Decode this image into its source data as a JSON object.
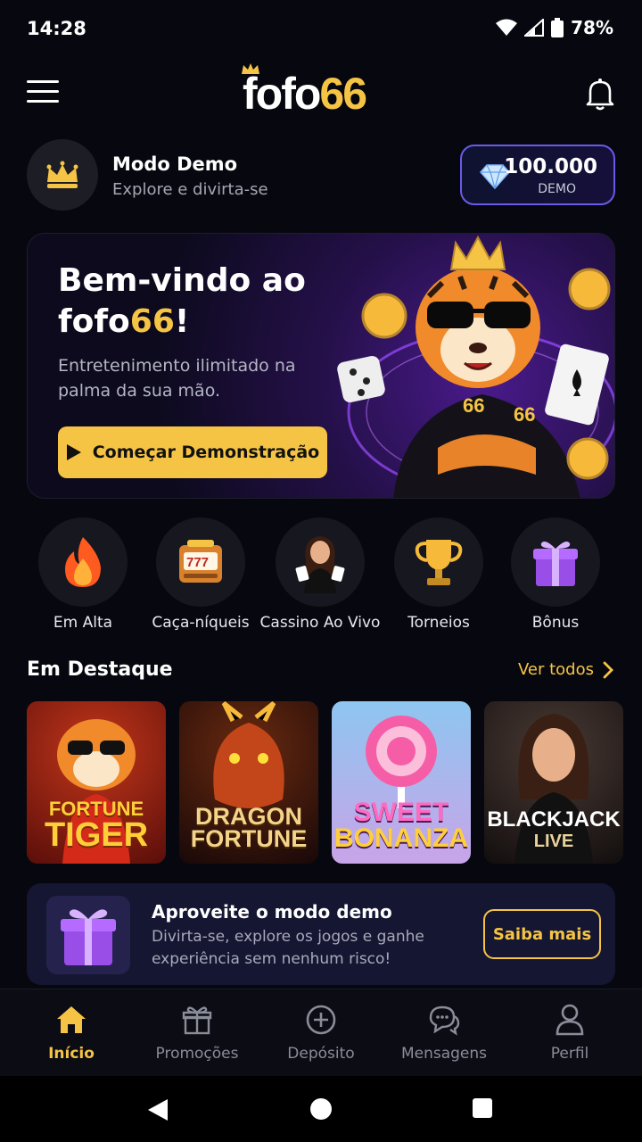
{
  "status_bar": {
    "time": "14:28",
    "battery": "78%"
  },
  "header": {
    "logo_part1": "fofo",
    "logo_part2": "66"
  },
  "demo": {
    "title": "Modo Demo",
    "subtitle": "Explore e divirta-se",
    "balance_amount": "100.000",
    "balance_label": "DEMO"
  },
  "hero": {
    "title_line1": "Bem-vindo ao",
    "title_brand1": "fofo",
    "title_brand2": "66",
    "title_end": "!",
    "description": "Entretenimento ilimitado na palma da sua mão.",
    "cta_label": "Começar Demonstração"
  },
  "categories": [
    {
      "label": "Em Alta",
      "icon": "fire-icon"
    },
    {
      "label": "Caça-níqueis",
      "icon": "slot-machine-icon"
    },
    {
      "label": "Cassino Ao Vivo",
      "icon": "live-dealer-icon"
    },
    {
      "label": "Torneios",
      "icon": "trophy-icon"
    },
    {
      "label": "Bônus",
      "icon": "gift-icon"
    }
  ],
  "featured": {
    "title": "Em Destaque",
    "see_all": "Ver todos",
    "games": [
      {
        "line1": "FORTUNE",
        "line2": "TIGER"
      },
      {
        "line1": "DRAGON",
        "line2": "FORTUNE"
      },
      {
        "line1": "SWEET",
        "line2": "BONANZA"
      },
      {
        "line1": "BLACKJACK",
        "line2": "LIVE"
      }
    ]
  },
  "promo": {
    "title": "Aproveite o modo demo",
    "text": "Divirta-se, explore os jogos e ganhe experiência sem nenhum risco!",
    "button": "Saiba mais"
  },
  "bottom_nav": [
    {
      "label": "Início",
      "icon": "home-icon",
      "active": true
    },
    {
      "label": "Promoções",
      "icon": "gift-icon"
    },
    {
      "label": "Depósito",
      "icon": "plus-circle-icon"
    },
    {
      "label": "Mensagens",
      "icon": "chat-icon"
    },
    {
      "label": "Perfil",
      "icon": "user-icon"
    }
  ],
  "colors": {
    "accent": "#f6c445",
    "background": "#07080f",
    "border_purple": "#6a5ae8"
  }
}
